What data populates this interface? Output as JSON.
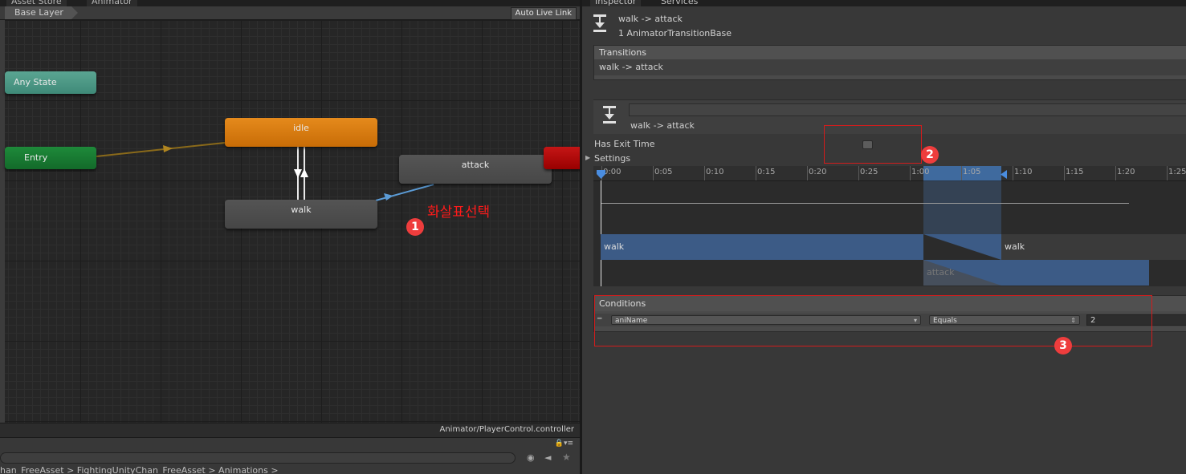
{
  "animator": {
    "tabs": [
      "Asset Store",
      "Animator"
    ],
    "breadcrumb": "Base Layer",
    "auto_live_link": "Auto Live Link",
    "nodes": {
      "any_state": "Any State",
      "entry": "Entry",
      "idle": "idle",
      "walk": "walk",
      "attack": "attack"
    },
    "annotation_text": "화살표선택",
    "annotation_badge": "1",
    "status_path": "Animator/PlayerControl.controller",
    "project_path": "han_FreeAsset > FightingUnityChan_FreeAsset > Animations >"
  },
  "inspector": {
    "tabs": [
      "Inspector",
      "Services"
    ],
    "title": "walk -> attack",
    "subtitle": "1 AnimatorTransitionBase",
    "transitions_header": "Transitions",
    "transitions_item": "walk -> attack",
    "transition_name": "walk -> attack",
    "has_exit_time_label": "Has Exit Time",
    "has_exit_time_value": false,
    "settings_label": "Settings",
    "badge2": "2",
    "badge3": "3",
    "timeline": {
      "ticks": [
        "0:00",
        "0:05",
        "0:10",
        "0:15",
        "0:20",
        "0:25",
        "1:00",
        "1:05",
        "1:10",
        "1:15",
        "1:20",
        "1:25"
      ],
      "clip_from": "walk",
      "clip_from_next": "walk",
      "clip_to": "attack"
    },
    "conditions_header": "Conditions",
    "condition": {
      "parameter": "aniName",
      "mode": "Equals",
      "value": "2"
    }
  },
  "colors": {
    "idle_node": "#d97a0f",
    "entry_node": "#1a7d34",
    "any_state_node": "#4d9a87",
    "annotation_red": "#ff1a1a",
    "selected_transition": "#5b9bd5"
  }
}
